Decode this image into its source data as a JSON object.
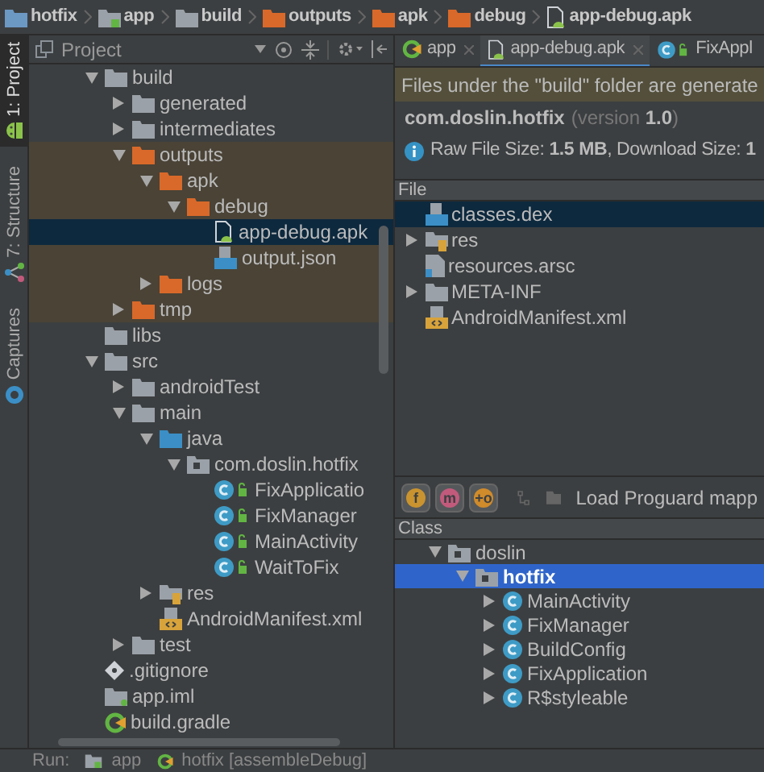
{
  "breadcrumbs": [
    {
      "label": "hotfix",
      "kind": "project"
    },
    {
      "label": "app",
      "kind": "module"
    },
    {
      "label": "build",
      "kind": "folder"
    },
    {
      "label": "outputs",
      "kind": "folder-orange"
    },
    {
      "label": "apk",
      "kind": "folder-orange"
    },
    {
      "label": "debug",
      "kind": "folder-orange"
    },
    {
      "label": "app-debug.apk",
      "kind": "apk"
    }
  ],
  "tool_windows": [
    {
      "label": "1: Project",
      "kind": "android",
      "selected": true
    },
    {
      "label": "7: Structure",
      "kind": "structure",
      "selected": false
    },
    {
      "label": "Captures",
      "kind": "captures",
      "selected": false
    }
  ],
  "project_panel": {
    "title": "Project",
    "tree": [
      {
        "label": "build",
        "kind": "folder",
        "expanded": true,
        "selected": false,
        "highlighted": false,
        "children": [
          {
            "label": "generated",
            "kind": "folder",
            "expanded": false,
            "selected": false,
            "highlighted": false
          },
          {
            "label": "intermediates",
            "kind": "folder",
            "expanded": false,
            "selected": false,
            "highlighted": false
          },
          {
            "label": "outputs",
            "kind": "folder-orange",
            "expanded": true,
            "selected": false,
            "highlighted": true,
            "children": [
              {
                "label": "apk",
                "kind": "folder-orange",
                "expanded": true,
                "selected": false,
                "highlighted": true,
                "children": [
                  {
                    "label": "debug",
                    "kind": "folder-orange",
                    "expanded": true,
                    "selected": false,
                    "highlighted": true,
                    "children": [
                      {
                        "label": "app-debug.apk",
                        "kind": "apk",
                        "selected": true,
                        "highlighted": true
                      },
                      {
                        "label": "output.json",
                        "kind": "json",
                        "selected": false,
                        "highlighted": true
                      }
                    ]
                  }
                ]
              },
              {
                "label": "logs",
                "kind": "folder-orange",
                "expanded": false,
                "selected": false,
                "highlighted": true
              }
            ]
          },
          {
            "label": "tmp",
            "kind": "folder-orange",
            "expanded": false,
            "selected": false,
            "highlighted": true
          }
        ]
      },
      {
        "label": "libs",
        "kind": "folder",
        "selected": false,
        "highlighted": false
      },
      {
        "label": "src",
        "kind": "folder",
        "expanded": true,
        "selected": false,
        "highlighted": false,
        "children": [
          {
            "label": "androidTest",
            "kind": "folder",
            "expanded": false,
            "selected": false,
            "highlighted": false
          },
          {
            "label": "main",
            "kind": "folder",
            "expanded": true,
            "selected": false,
            "highlighted": false,
            "children": [
              {
                "label": "java",
                "kind": "folder-blue",
                "expanded": true,
                "selected": false,
                "highlighted": false,
                "children": [
                  {
                    "label": "com.doslin.hotfix",
                    "kind": "package",
                    "expanded": true,
                    "selected": false,
                    "highlighted": false,
                    "children": [
                      {
                        "label": "FixApplicatio",
                        "kind": "class",
                        "selected": false,
                        "highlighted": false
                      },
                      {
                        "label": "FixManager",
                        "kind": "class",
                        "selected": false,
                        "highlighted": false
                      },
                      {
                        "label": "MainActivity",
                        "kind": "class",
                        "selected": false,
                        "highlighted": false
                      },
                      {
                        "label": "WaitToFix",
                        "kind": "class",
                        "selected": false,
                        "highlighted": false
                      }
                    ]
                  }
                ]
              },
              {
                "label": "res",
                "kind": "res",
                "expanded": false,
                "selected": false,
                "highlighted": false
              },
              {
                "label": "AndroidManifest.xml",
                "kind": "manifest",
                "selected": false,
                "highlighted": false
              }
            ]
          },
          {
            "label": "test",
            "kind": "folder",
            "expanded": false,
            "selected": false,
            "highlighted": false
          }
        ]
      },
      {
        "label": ".gitignore",
        "kind": "git",
        "selected": false,
        "highlighted": false
      },
      {
        "label": "app.iml",
        "kind": "iml",
        "selected": false,
        "highlighted": false
      },
      {
        "label": "build.gradle",
        "kind": "gradle",
        "selected": false,
        "highlighted": false
      }
    ]
  },
  "editor_tabs": [
    {
      "label": "app",
      "kind": "gradle",
      "selected": false,
      "closable": true
    },
    {
      "label": "app-debug.apk",
      "kind": "apk",
      "selected": true,
      "closable": true
    },
    {
      "label": "FixAppl",
      "kind": "class",
      "selected": false,
      "closable": false
    }
  ],
  "banner": "Files under the \"build\" folder are generate",
  "apk_info": {
    "app_id": "com.doslin.hotfix",
    "version": "(version **1.0**)",
    "sizes": "Raw File Size: **1.5 MB**, Download Size: **1**"
  },
  "file_table": {
    "column": "File",
    "rows": [
      {
        "label": "classes.dex",
        "kind": "dex",
        "selected": true
      },
      {
        "label": "res",
        "kind": "res",
        "expanded": false,
        "selected": false
      },
      {
        "label": "resources.arsc",
        "kind": "arsc",
        "selected": false
      },
      {
        "label": "META-INF",
        "kind": "folder",
        "expanded": false,
        "selected": false
      },
      {
        "label": "AndroidManifest.xml",
        "kind": "manifest",
        "selected": false
      }
    ]
  },
  "class_toolbar": {
    "buttons": [
      {
        "label": "f",
        "color": "#c9932f"
      },
      {
        "label": "m",
        "color": "#c25a7c"
      },
      {
        "label": "+o",
        "color": "#d08b2a"
      }
    ],
    "action": "Load Proguard mapp"
  },
  "class_tree": {
    "column": "Class",
    "tree": [
      {
        "label": "doslin",
        "kind": "package",
        "expanded": true,
        "selected": false,
        "children": [
          {
            "label": "hotfix",
            "kind": "package",
            "expanded": true,
            "selected": true,
            "children": [
              {
                "label": "MainActivity",
                "kind": "class-plain",
                "expanded": false,
                "selected": false
              },
              {
                "label": "FixManager",
                "kind": "class-plain",
                "expanded": false,
                "selected": false
              },
              {
                "label": "BuildConfig",
                "kind": "class-plain",
                "expanded": false,
                "selected": false
              },
              {
                "label": "FixApplication",
                "kind": "class-plain",
                "expanded": false,
                "selected": false
              },
              {
                "label": "R$styleable",
                "kind": "class-plain",
                "expanded": false,
                "selected": false
              }
            ]
          }
        ]
      }
    ]
  },
  "run_bar": {
    "label": "Run:",
    "tabs": [
      {
        "label": "app",
        "kind": "module"
      },
      {
        "label": "hotfix [assembleDebug]",
        "kind": "gradle"
      }
    ]
  }
}
